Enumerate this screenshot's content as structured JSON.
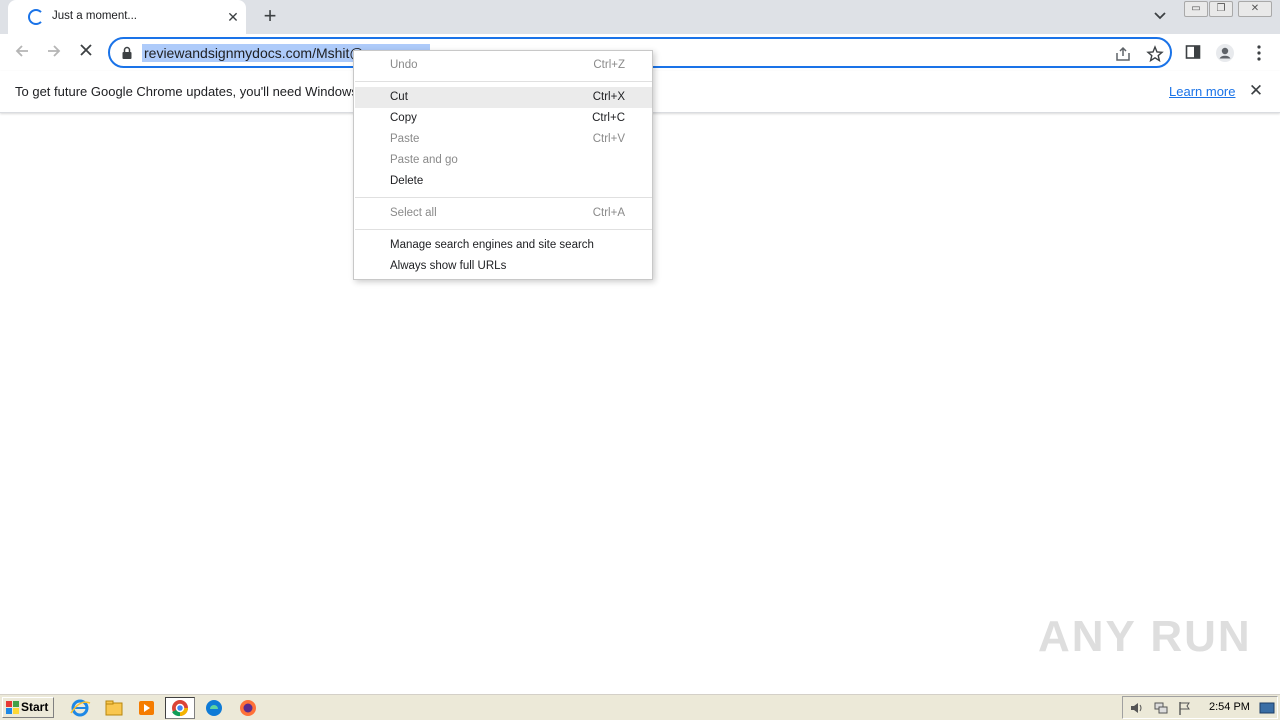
{
  "tab": {
    "title": "Just a moment...",
    "close": "✕"
  },
  "newtab": "+",
  "omnibox": {
    "url": "reviewandsignmydocs.com/Mshit@…"
  },
  "infobar": {
    "message": "To get future Google Chrome updates, you'll need Windows 1",
    "learn_more": "Learn more",
    "close": "✕"
  },
  "context_menu": {
    "items": [
      {
        "label": "Undo",
        "shortcut": "Ctrl+Z"
      },
      {
        "label": "Cut",
        "shortcut": "Ctrl+X"
      },
      {
        "label": "Copy",
        "shortcut": "Ctrl+C"
      },
      {
        "label": "Paste",
        "shortcut": "Ctrl+V"
      },
      {
        "label": "Paste and go",
        "shortcut": ""
      },
      {
        "label": "Delete",
        "shortcut": ""
      },
      {
        "label": "Select all",
        "shortcut": "Ctrl+A"
      },
      {
        "label": "Manage search engines and site search",
        "shortcut": ""
      },
      {
        "label": "Always show full URLs",
        "shortcut": ""
      }
    ]
  },
  "watermark": "ANY RUN",
  "taskbar": {
    "start": "Start",
    "clock": "2:54 PM"
  },
  "colors": {
    "accent": "#1a73e8",
    "selection": "#aecbfa",
    "tabstrip": "#dee1e6"
  }
}
